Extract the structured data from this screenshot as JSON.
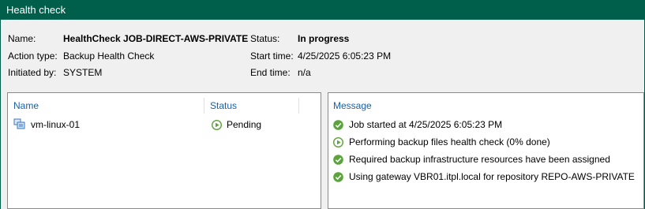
{
  "window": {
    "title": "Health check"
  },
  "details": {
    "name_label": "Name:",
    "name_value": "HealthCheck JOB-DIRECT-AWS-PRIVATE",
    "action_label": "Action type:",
    "action_value": "Backup Health Check",
    "initiated_label": "Initiated by:",
    "initiated_value": "SYSTEM",
    "status_label": "Status:",
    "status_value": "In progress",
    "start_label": "Start time:",
    "start_value": "4/25/2025 6:05:23 PM",
    "end_label": "End time:",
    "end_value": "n/a"
  },
  "objects_table": {
    "columns": {
      "name": "Name",
      "status": "Status"
    },
    "rows": [
      {
        "name": "vm-linux-01",
        "status": "Pending",
        "status_icon": "play-circle-icon"
      }
    ]
  },
  "messages": {
    "header": "Message",
    "items": [
      {
        "text": "Job started at 4/25/2025 6:05:23 PM",
        "icon": "success-check-icon"
      },
      {
        "text": "Performing backup files health check (0% done)",
        "icon": "in-progress-play-icon"
      },
      {
        "text": "Required backup infrastructure resources have been assigned",
        "icon": "success-check-icon"
      },
      {
        "text": "Using gateway VBR01.itpl.local for repository REPO-AWS-PRIVATE",
        "icon": "success-check-icon"
      }
    ]
  },
  "colors": {
    "titlebar": "#005f4b",
    "header_text": "#1a5fa8",
    "success": "#5ba33b"
  }
}
